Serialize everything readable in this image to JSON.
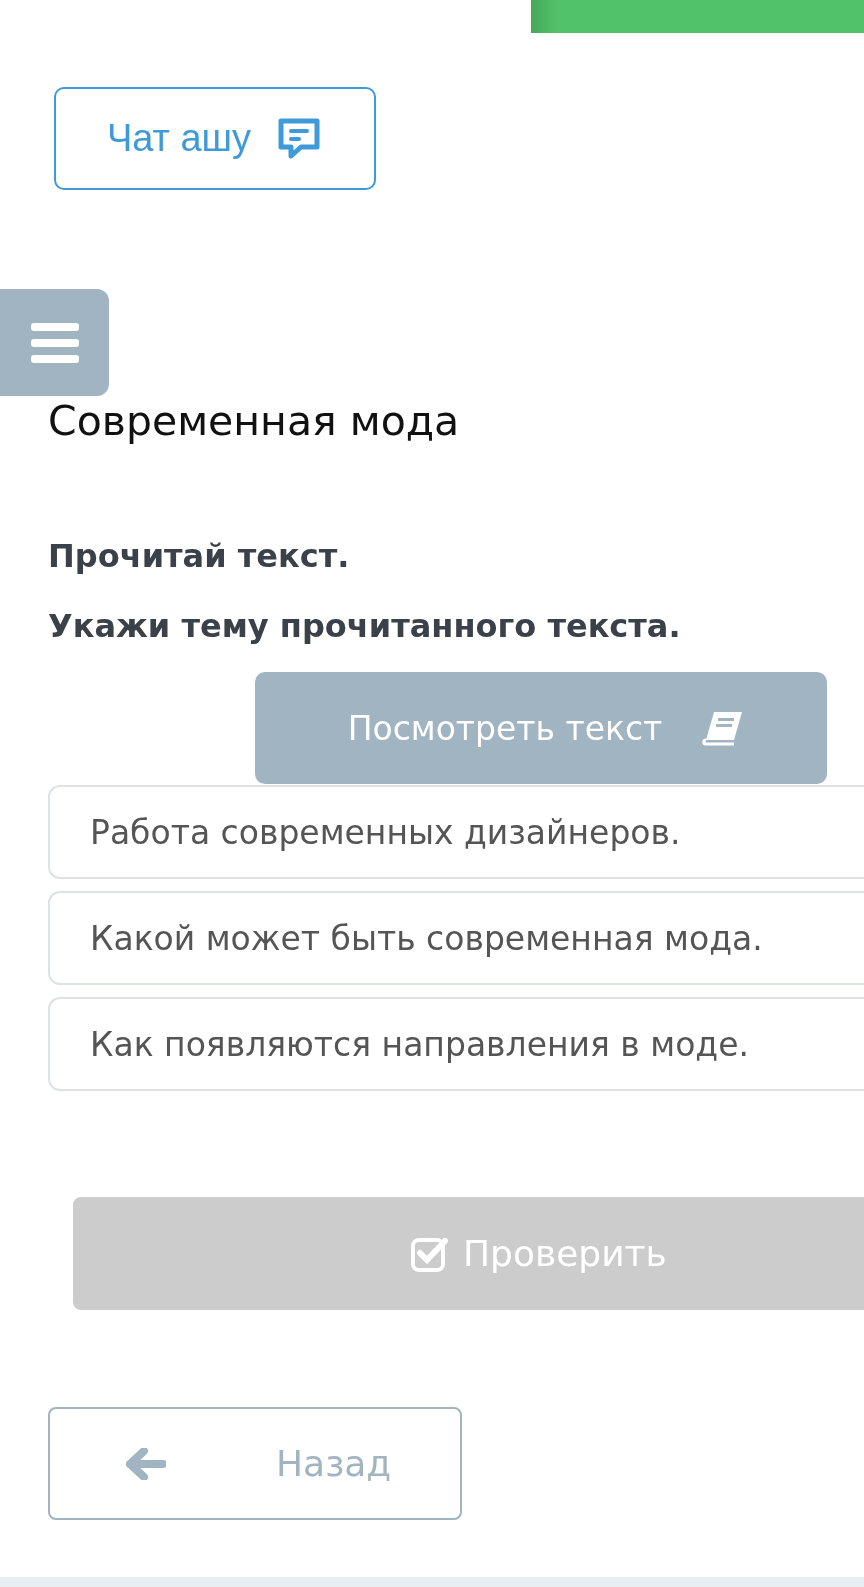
{
  "progress": {
    "level": 0.385
  },
  "chat_button": {
    "label": "Чат ашу"
  },
  "title": "Современная мода",
  "instructions": [
    "Прочитай текст.",
    "Укажи тему прочитанного текста."
  ],
  "view_text_button": {
    "label": "Посмотреть текст"
  },
  "options": [
    {
      "text": "Работа современных дизайнеров."
    },
    {
      "text": "Какой может быть современная мода."
    },
    {
      "text": "Как появляются направления в моде."
    }
  ],
  "check_button": {
    "label": "Проверить",
    "disabled": true
  },
  "back_button": {
    "label": "Назад"
  }
}
